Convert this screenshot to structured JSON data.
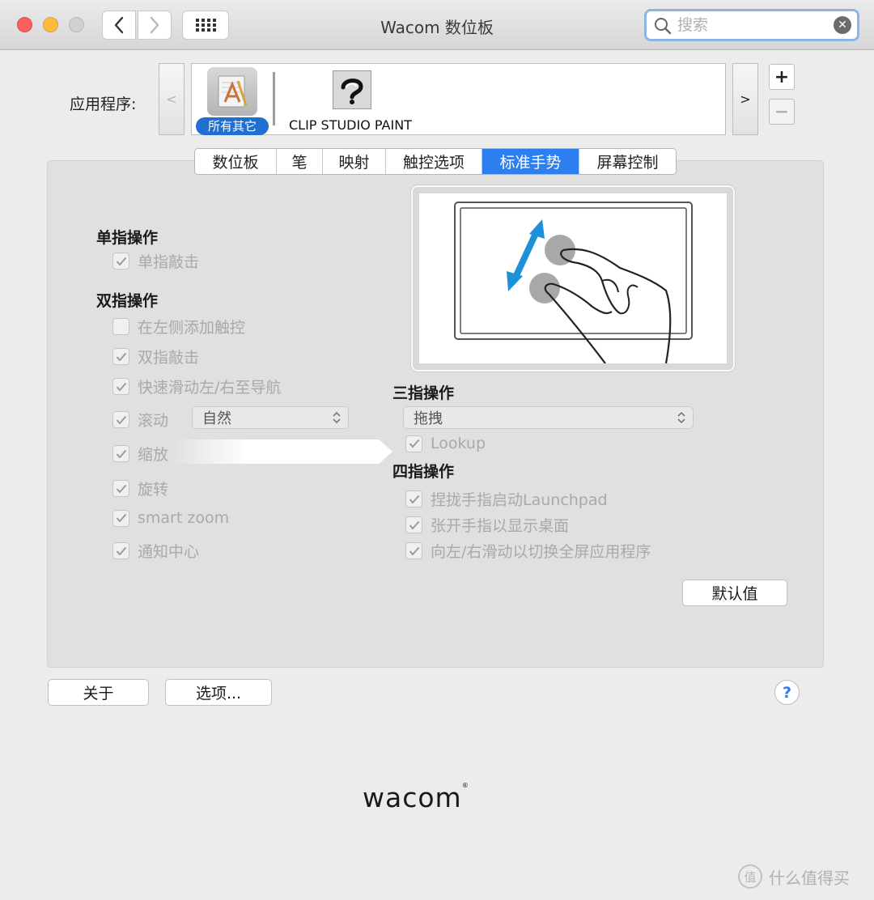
{
  "window": {
    "title": "Wacom 数位板"
  },
  "search": {
    "placeholder": "搜索"
  },
  "apps": {
    "label": "应用程序:",
    "scroll_left": "<",
    "scroll_right": ">",
    "items": [
      {
        "label": "所有其它",
        "selected": true
      },
      {
        "label": "CLIP STUDIO PAINT",
        "selected": false
      }
    ],
    "add": "+",
    "remove": "−"
  },
  "tabs": [
    {
      "label": "数位板",
      "active": false
    },
    {
      "label": "笔",
      "active": false
    },
    {
      "label": "映射",
      "active": false
    },
    {
      "label": "触控选项",
      "active": false
    },
    {
      "label": "标准手势",
      "active": true
    },
    {
      "label": "屏幕控制",
      "active": false
    }
  ],
  "one_finger": {
    "title": "单指操作",
    "options": [
      {
        "label": "单指敲击",
        "checked": true
      }
    ]
  },
  "two_finger": {
    "title": "双指操作",
    "options": [
      {
        "label": "在左侧添加触控",
        "checked": false
      },
      {
        "label": "双指敲击",
        "checked": true
      },
      {
        "label": "快速滑动左/右至导航",
        "checked": true
      },
      {
        "label": "滚动",
        "checked": true
      },
      {
        "label": "缩放",
        "checked": true
      },
      {
        "label": "旋转",
        "checked": true
      },
      {
        "label": "smart zoom",
        "checked": true
      },
      {
        "label": "通知中心",
        "checked": true
      }
    ],
    "scroll_select": "自然"
  },
  "three_finger": {
    "title": "三指操作",
    "select": "拖拽",
    "options": [
      {
        "label": "Lookup",
        "checked": true
      }
    ]
  },
  "four_finger": {
    "title": "四指操作",
    "options": [
      {
        "label": "捏拢手指启动Launchpad",
        "checked": true
      },
      {
        "label": "张开手指以显示桌面",
        "checked": true
      },
      {
        "label": "向左/右滑动以切换全屏应用程序",
        "checked": true
      }
    ]
  },
  "buttons": {
    "default": "默认值",
    "about": "关于",
    "options": "选项...",
    "help": "?"
  },
  "brand": {
    "logo": "wacom"
  },
  "watermark": {
    "icon": "值",
    "text": "什么值得买"
  },
  "colors": {
    "accent": "#2d7ff0",
    "selected_pill": "#1e6fd0",
    "gesture_arrow": "#1e90d8"
  }
}
